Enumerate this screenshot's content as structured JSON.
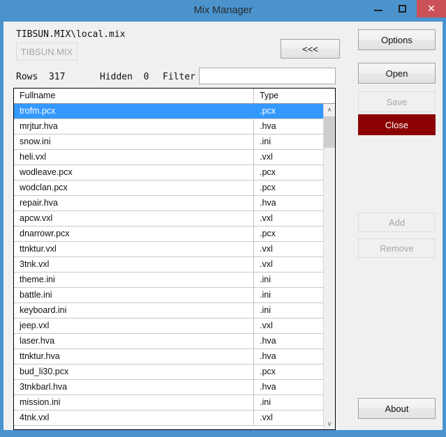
{
  "window": {
    "title": "Mix Manager",
    "controls": {
      "minimize": "minimize-icon",
      "maximize": "maximize-icon",
      "close": "✕"
    },
    "frame_color": "#4a93cd",
    "close_button_color": "#cb5158"
  },
  "toolbar": {
    "path": "TIBSUN.MIX\\local.mix",
    "archive_button": "TIBSUN.MIX",
    "back_button": "<<<"
  },
  "status": {
    "rows_label": "Rows",
    "rows_value": "317",
    "hidden_label": "Hidden",
    "hidden_value": "0",
    "rows_text": "Rows  317",
    "hidden_text": "Hidden  0",
    "filter_label": "Filter",
    "filter_value": "",
    "filter_placeholder": ""
  },
  "grid": {
    "columns": [
      "Fullname",
      "Type"
    ],
    "selected_index": 0,
    "selection_color": "#3399ff",
    "rows": [
      {
        "fullname": "trofm.pcx",
        "type": ".pcx"
      },
      {
        "fullname": "mrjtur.hva",
        "type": ".hva"
      },
      {
        "fullname": "snow.ini",
        "type": ".ini"
      },
      {
        "fullname": "heli.vxl",
        "type": ".vxl"
      },
      {
        "fullname": "wodleave.pcx",
        "type": ".pcx"
      },
      {
        "fullname": "wodclan.pcx",
        "type": ".pcx"
      },
      {
        "fullname": "repair.hva",
        "type": ".hva"
      },
      {
        "fullname": "apcw.vxl",
        "type": ".vxl"
      },
      {
        "fullname": "dnarrowr.pcx",
        "type": ".pcx"
      },
      {
        "fullname": "ttnktur.vxl",
        "type": ".vxl"
      },
      {
        "fullname": "3tnk.vxl",
        "type": ".vxl"
      },
      {
        "fullname": "theme.ini",
        "type": ".ini"
      },
      {
        "fullname": "battle.ini",
        "type": ".ini"
      },
      {
        "fullname": "keyboard.ini",
        "type": ".ini"
      },
      {
        "fullname": "jeep.vxl",
        "type": ".vxl"
      },
      {
        "fullname": "laser.hva",
        "type": ".hva"
      },
      {
        "fullname": "ttnktur.hva",
        "type": ".hva"
      },
      {
        "fullname": "bud_li30.pcx",
        "type": ".pcx"
      },
      {
        "fullname": "3tnkbarl.hva",
        "type": ".hva"
      },
      {
        "fullname": "mission.ini",
        "type": ".ini"
      },
      {
        "fullname": "4tnk.vxl",
        "type": ".vxl"
      }
    ],
    "scrollbar": {
      "up_arrow": "∧",
      "down_arrow": "∨"
    }
  },
  "side_buttons": {
    "options": "Options",
    "open": "Open",
    "save": "Save",
    "close": "Close",
    "add": "Add",
    "remove": "Remove",
    "about": "About",
    "close_color": "#8b0000"
  }
}
